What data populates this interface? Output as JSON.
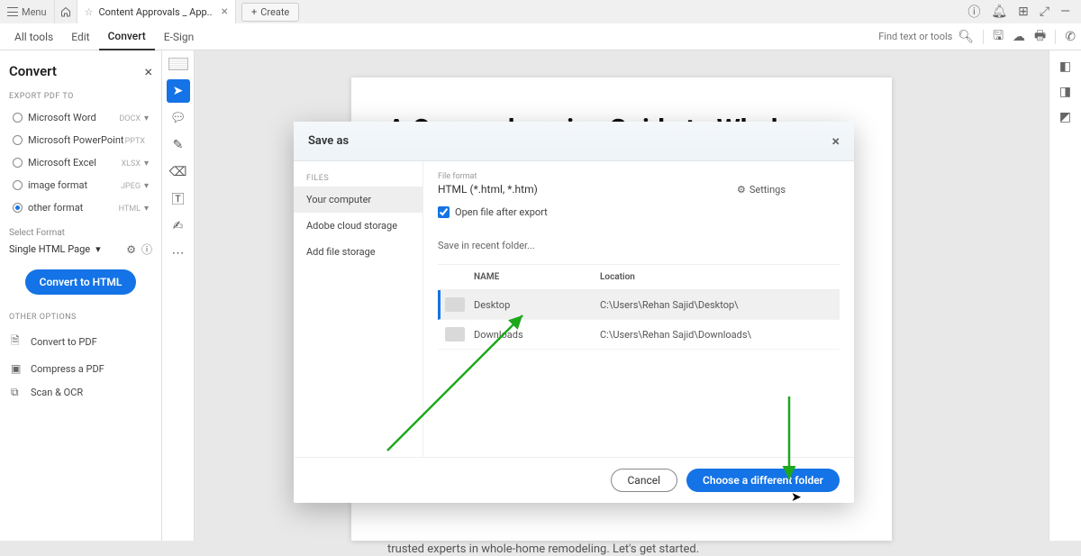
{
  "titlebar": {
    "menu": "Menu",
    "tab_title": "Content Approvals _ App..",
    "create": "Create"
  },
  "toolbar": {
    "all_tools": "All tools",
    "edit": "Edit",
    "convert": "Convert",
    "esign": "E-Sign",
    "search_placeholder": "Find text or tools"
  },
  "panel": {
    "title": "Convert",
    "export_label": "EXPORT PDF TO",
    "options": [
      {
        "label": "Microsoft Word",
        "fmt": "DOCX"
      },
      {
        "label": "Microsoft PowerPoint",
        "fmt": "PPTX"
      },
      {
        "label": "Microsoft Excel",
        "fmt": "XLSX"
      },
      {
        "label": "image format",
        "fmt": "JPEG"
      },
      {
        "label": "other format",
        "fmt": "HTML"
      }
    ],
    "select_format_label": "Select Format",
    "select_format_value": "Single HTML Page",
    "convert_button": "Convert to HTML",
    "other_options_label": "OTHER OPTIONS",
    "other_options": [
      "Convert to PDF",
      "Compress a PDF",
      "Scan & OCR"
    ]
  },
  "document": {
    "heading": "A Comprehensive Guide to Whole-",
    "body_tail": "trusted experts in whole-home remodeling. Let's get started."
  },
  "modal": {
    "title": "Save as",
    "files_label": "FILES",
    "side_items": [
      "Your computer",
      "Adobe cloud storage",
      "Add file storage"
    ],
    "file_format_label": "File format",
    "file_format_value": "HTML (*.html, *.htm)",
    "settings": "Settings",
    "open_after": "Open file after export",
    "recent_label": "Save in recent folder...",
    "col_name": "NAME",
    "col_location": "Location",
    "folders": [
      {
        "name": "Desktop",
        "location": "C:\\Users\\Rehan Sajid\\Desktop\\"
      },
      {
        "name": "Downloads",
        "location": "C:\\Users\\Rehan Sajid\\Downloads\\"
      }
    ],
    "cancel": "Cancel",
    "primary": "Choose a different folder"
  }
}
